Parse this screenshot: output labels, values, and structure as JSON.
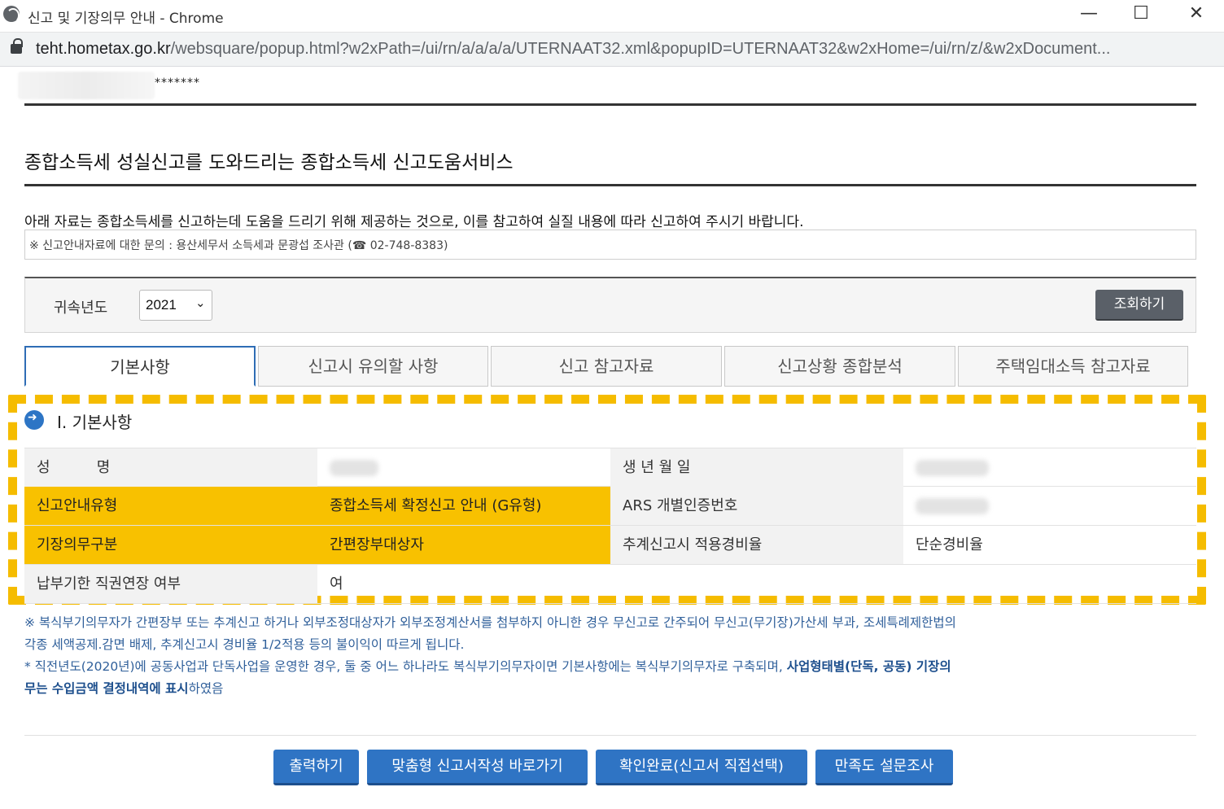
{
  "window": {
    "title": "신고 및 기장의무 안내 - Chrome",
    "minimize": "—",
    "maximize": "☐",
    "close": "✕"
  },
  "address": {
    "host": "teht.hometax.go.kr",
    "path": "/websquare/popup.html?w2xPath=/ui/rn/a/a/a/a/UTERNAAT32.xml&popupID=UTERNAAT32&w2xHome=/ui/rn/z/&w2xDocument..."
  },
  "header": {
    "masked_suffix": "*******",
    "title": "종합소득세 성실신고를 도와드리는 종합소득세 신고도움서비스",
    "intro": "아래 자료는 종합소득세를 신고하는데 도움을 드리기 위해 제공하는 것으로, 이를 참고하여 실질 내용에 따라 신고하여 주시기 바랍니다.",
    "inquiry": "※ 신고안내자료에 대한 문의 : 용산세무서 소득세과 문광섭 조사관 (☎ 02-748-8383)"
  },
  "search": {
    "label": "귀속년도",
    "year": "2021",
    "chevron": "⌄",
    "button": "조회하기"
  },
  "tabs": [
    {
      "label": "기본사항"
    },
    {
      "label": "신고시 유의할 사항"
    },
    {
      "label": "신고 참고자료"
    },
    {
      "label": "신고상황 종합분석"
    },
    {
      "label": "주택임대소득 참고자료"
    }
  ],
  "section": {
    "title": "Ⅰ. 기본사항"
  },
  "info": {
    "name_label": "성          명",
    "birth_label": "생  년  월  일",
    "guide_type_label": "신고안내유형",
    "guide_type_value": "종합소득세 확정신고 안내 (G유형)",
    "ars_label": "ARS 개별인증번호",
    "bookkeeping_label": "기장의무구분",
    "bookkeeping_value": "간편장부대상자",
    "expense_label": "추계신고시 적용경비율",
    "expense_value": "단순경비율",
    "extension_label": "납부기한 직권연장 여부",
    "extension_value": "여"
  },
  "notes": {
    "line1": "※ 복식부기의무자가 간편장부 또는 추계신고 하거나 외부조정대상자가 외부조정계산서를 첨부하지 아니한 경우 무신고로 간주되어 무신고(무기장)가산세 부과, 조세특례제한법의",
    "line2": "각종 세액공제.감면 배제, 추계신고시 경비율 1/2적용 등의 불이익이 따르게 됩니다.",
    "line3a": "* 직전년도(2020년)에 공동사업과 단독사업을 운영한 경우, 둘 중 어느 하나라도 복식부기의무자이면 기본사항에는 복식부기의무자로 구축되며, ",
    "line3b": "사업형태별(단독, 공동) 기장의",
    "line4a": "무는 수입금액 결정내역에 표시",
    "line4b": "하였음"
  },
  "actions": {
    "print": "출력하기",
    "custom": "맞춤형 신고서작성 바로가기",
    "confirm": "확인완료(신고서 직접선택)",
    "survey": "만족도 설문조사"
  },
  "colors": {
    "accent": "#2f74c4",
    "highlight": "#f8c100",
    "dashed": "#f5bc00"
  }
}
